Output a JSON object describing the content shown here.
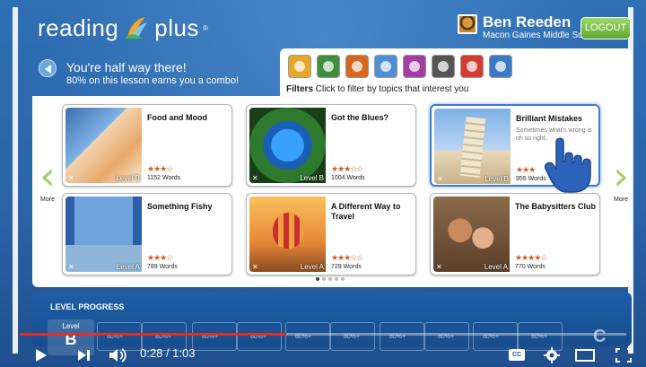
{
  "header": {
    "brand_left": "reading",
    "brand_right": "plus",
    "trademark": "®",
    "user_name": "Ben Reeden",
    "school": "Macon Gaines Middle School",
    "logout_label": "LOGOUT"
  },
  "banner": {
    "title": "You're half way there!",
    "subtitle": "80% on this lesson earns you a combo!"
  },
  "filters": {
    "label_bold": "Filters",
    "label_rest": "Click to filter by topics that interest you",
    "icons": [
      {
        "name": "people-icon",
        "color": "#e8a62a"
      },
      {
        "name": "globe-icon",
        "color": "#3d8f3a"
      },
      {
        "name": "flame-icon",
        "color": "#d9661e"
      },
      {
        "name": "magnifier-icon",
        "color": "#4e8fd6"
      },
      {
        "name": "briefcase-icon",
        "color": "#a23ea6"
      },
      {
        "name": "tools-icon",
        "color": "#555555"
      },
      {
        "name": "gear-icon",
        "color": "#d63b2f"
      },
      {
        "name": "satellite-icon",
        "color": "#3a78c9"
      }
    ]
  },
  "nav": {
    "prev_label": "More",
    "next_label": "More"
  },
  "cards": [
    {
      "title": "Food and Mood",
      "desc": "",
      "stars": "★★★☆",
      "words": "1152 Words",
      "level": "Level B"
    },
    {
      "title": "Got the Blues?",
      "desc": "",
      "stars": "★★★☆☆",
      "words": "1004 Words",
      "level": "Level B"
    },
    {
      "title": "Brilliant Mistakes",
      "desc": "Sometimes what's wrong is oh so right.",
      "stars": "★★★",
      "words": "955 Words",
      "level": "Level B"
    },
    {
      "title": "Something Fishy",
      "desc": "",
      "stars": "★★★☆",
      "words": "789 Words",
      "level": "Level A"
    },
    {
      "title": "A Different Way to Travel",
      "desc": "",
      "stars": "★★★☆☆",
      "words": "729 Words",
      "level": "Level A"
    },
    {
      "title": "The Babysitters Club",
      "desc": "",
      "stars": "★★★★☆",
      "words": "770 Words",
      "level": "Level A"
    }
  ],
  "progress": {
    "label": "LEVEL PROGRESS",
    "current_level_title": "Level",
    "current_level": "B",
    "next_level": "C",
    "cell_text": "80%+"
  },
  "video": {
    "time": "0:28 / 1:03",
    "played_fraction": 0.44,
    "cc_label": "CC"
  }
}
